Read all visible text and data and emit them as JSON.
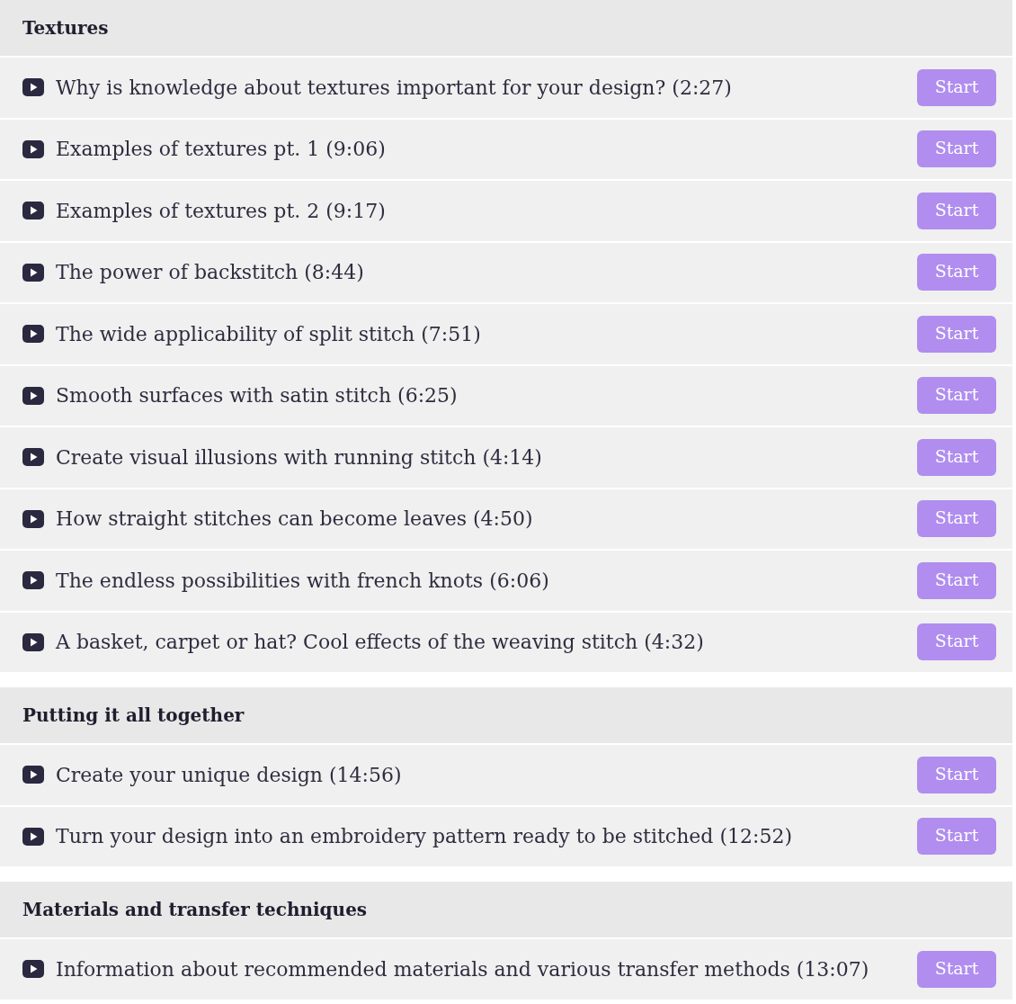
{
  "sections": [
    {
      "title": "Textures",
      "lessons": [
        {
          "title": "Why is knowledge about textures important for your design? (2:27)",
          "action": "Start"
        },
        {
          "title": "Examples of textures pt. 1 (9:06)",
          "action": "Start"
        },
        {
          "title": "Examples of textures pt. 2 (9:17)",
          "action": "Start"
        },
        {
          "title": "The power of backstitch (8:44)",
          "action": "Start"
        },
        {
          "title": "The wide applicability of split stitch (7:51)",
          "action": "Start"
        },
        {
          "title": "Smooth surfaces with satin stitch (6:25)",
          "action": "Start"
        },
        {
          "title": "Create visual illusions with running stitch (4:14)",
          "action": "Start"
        },
        {
          "title": "How straight stitches can become leaves (4:50)",
          "action": "Start"
        },
        {
          "title": "The endless possibilities with french knots (6:06)",
          "action": "Start"
        },
        {
          "title": "A basket, carpet or hat? Cool effects of the weaving stitch (4:32)",
          "action": "Start"
        }
      ]
    },
    {
      "title": "Putting it all together",
      "lessons": [
        {
          "title": "Create your unique design (14:56)",
          "action": "Start"
        },
        {
          "title": "Turn your design into an embroidery pattern ready to be stitched (12:52)",
          "action": "Start"
        }
      ]
    },
    {
      "title": "Materials and transfer techniques",
      "lessons": [
        {
          "title": "Information about recommended materials and various transfer methods (13:07)",
          "action": "Start"
        }
      ]
    }
  ]
}
